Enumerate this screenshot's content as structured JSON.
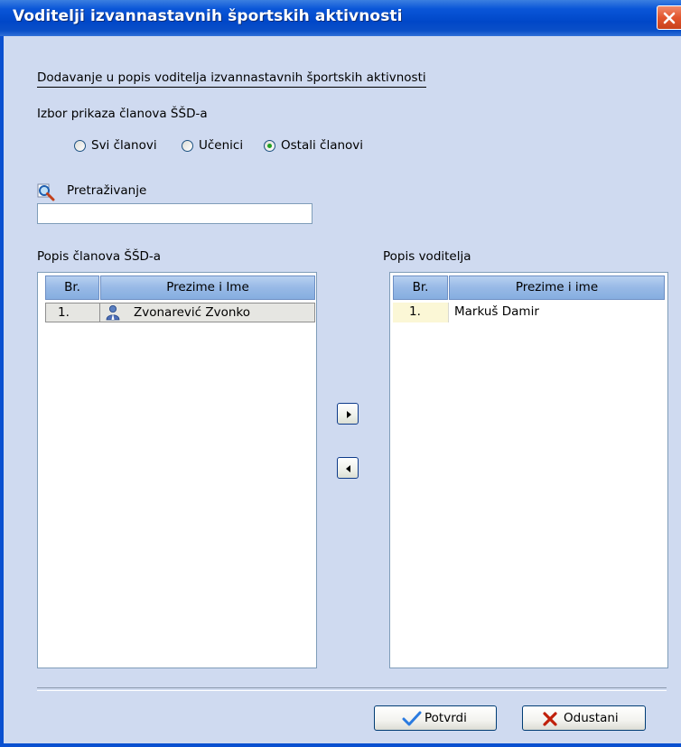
{
  "window": {
    "title": "Voditelji izvannastavnih športskih aktivnosti"
  },
  "heading": "Dodavanje u popis voditelja izvannastavnih športskih aktivnosti",
  "filter": {
    "label": "Izbor prikaza članova ŠŠD-a",
    "options": [
      {
        "label": "Svi članovi",
        "selected": false
      },
      {
        "label": "Učenici",
        "selected": false
      },
      {
        "label": "Ostali članovi",
        "selected": true
      }
    ]
  },
  "search": {
    "label": "Pretraživanje",
    "value": "",
    "icon": "magnifier-icon"
  },
  "members_list": {
    "label": "Popis članova ŠŠD-a",
    "columns": [
      "Br.",
      "Prezime i Ime"
    ],
    "rows": [
      {
        "num": "1.",
        "name": "Zvonarević Zvonko",
        "icon": "person-icon"
      }
    ]
  },
  "leaders_list": {
    "label": "Popis voditelja",
    "columns": [
      "Br.",
      "Prezime i ime"
    ],
    "rows": [
      {
        "num": "1.",
        "name": "Markuš Damir"
      }
    ]
  },
  "buttons": {
    "confirm": "Potvrdi",
    "cancel": "Odustani"
  },
  "colors": {
    "window_bg": "#cfdaf0",
    "titlebar": "#0a56d8",
    "confirm_check": "#2b7be0",
    "cancel_x": "#c0200a"
  }
}
